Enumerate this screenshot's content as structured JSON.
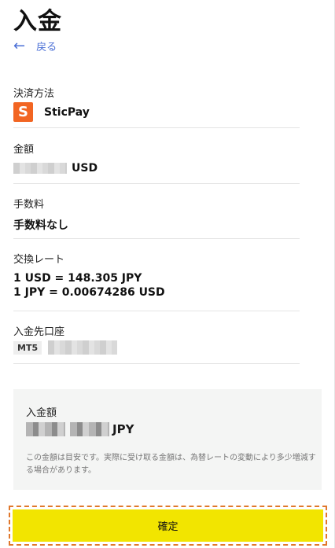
{
  "page": {
    "title": "入金",
    "back_label": "戻る"
  },
  "payment_method": {
    "label": "決済方法",
    "value": "SticPay",
    "logo_letter": "S"
  },
  "amount": {
    "label": "金額",
    "currency": "USD"
  },
  "fee": {
    "label": "手数料",
    "value": "手数料なし"
  },
  "exchange_rate": {
    "label": "交換レート",
    "line1": "1 USD = 148.305 JPY",
    "line2": "1 JPY = 0.00674286 USD"
  },
  "deposit_account": {
    "label": "入金先口座",
    "platform": "MT5"
  },
  "summary": {
    "label": "入金額",
    "currency": "JPY",
    "note": "この金額は目安です。実際に受け取る金額は、為替レートの変動により多少増減する場合があります。"
  },
  "confirm": {
    "label": "確定"
  },
  "colors": {
    "accent_link": "#4a6fd6",
    "confirm_button": "#f2e500",
    "sticpay_brand": "#f26522",
    "highlight_border": "#e0782c"
  }
}
